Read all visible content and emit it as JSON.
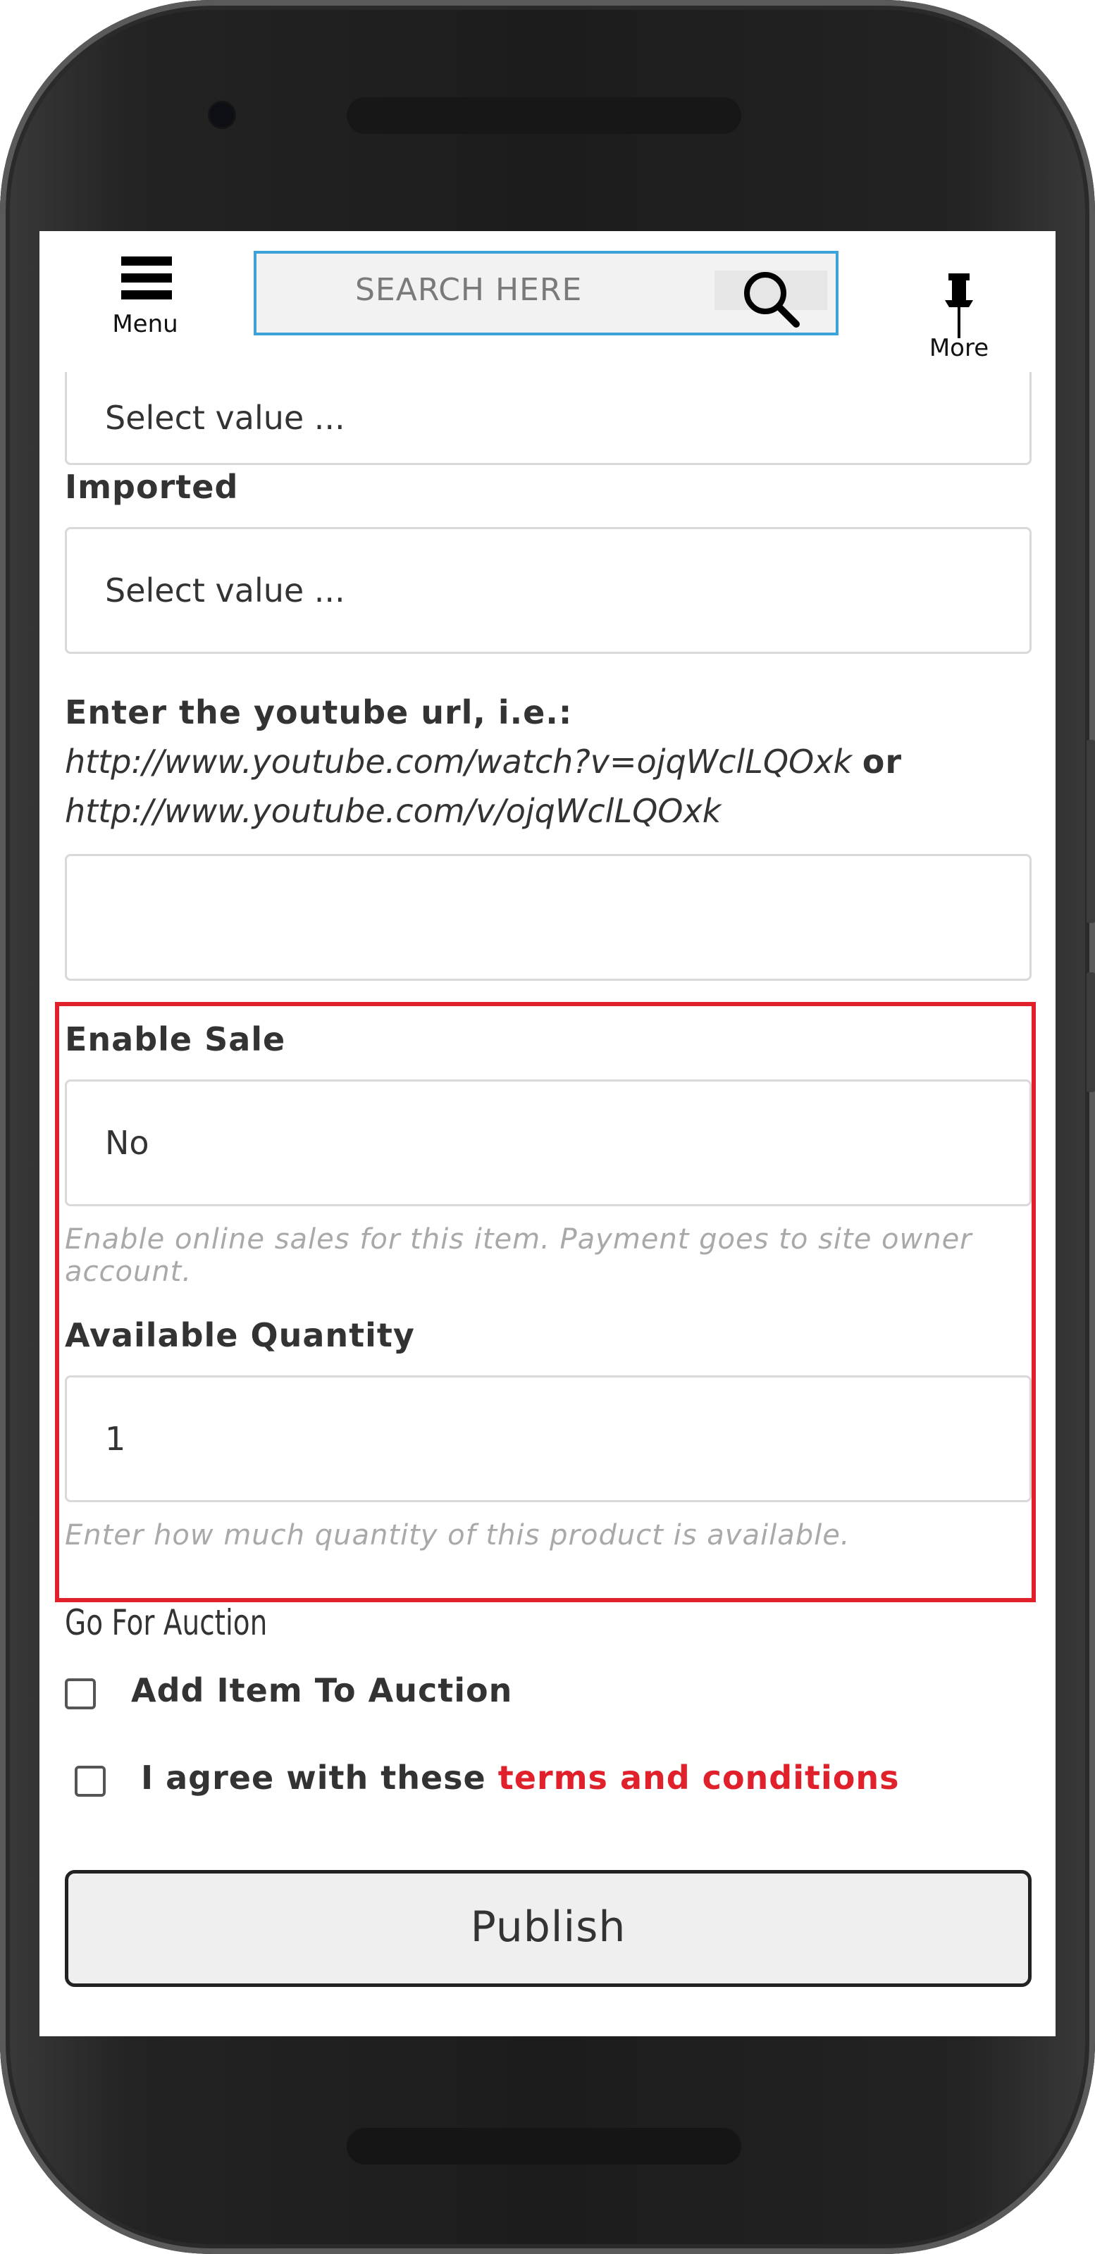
{
  "header": {
    "menu_label": "Menu",
    "search_placeholder": "SEARCH HERE",
    "more_label": "More"
  },
  "form": {
    "prev_select_value": "Select value ...",
    "imported": {
      "label": "Imported",
      "value": "Select value ..."
    },
    "youtube": {
      "label": "Enter the youtube url, i.e.:",
      "example1": "http://www.youtube.com/watch?v=ojqWclLQOxk",
      "or": "or",
      "example2": "http://www.youtube.com/v/ojqWclLQOxk",
      "value": ""
    },
    "enable_sale": {
      "label": "Enable Sale",
      "value": "No",
      "help": "Enable online sales for this item. Payment goes to site owner account."
    },
    "available_quantity": {
      "label": "Available Quantity",
      "value": "1",
      "help": "Enter how much quantity of this product is available."
    },
    "auction": {
      "heading": "Go For Auction",
      "checkbox_label": "Add Item To Auction",
      "checked": false
    },
    "terms": {
      "prefix": "I agree with these",
      "link": "terms and conditions",
      "checked": false
    },
    "publish_label": "Publish"
  },
  "colors": {
    "accent_red": "#e0202a",
    "search_border": "#3ba3d8"
  }
}
